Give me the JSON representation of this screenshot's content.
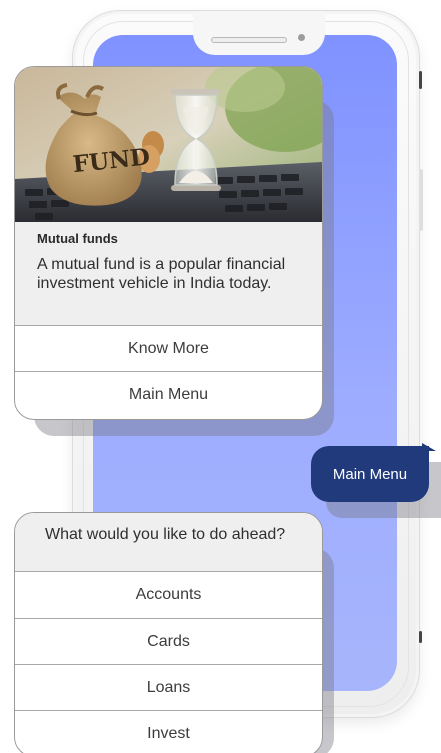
{
  "card_primary": {
    "title": "Mutual funds",
    "description": "A mutual fund is a popular financial investment vehicle in India today.",
    "image_label": "FUND",
    "buttons": [
      "Know More",
      "Main Menu"
    ]
  },
  "user_message": {
    "text": "Main Menu"
  },
  "card_menu": {
    "prompt": "What would you like to do ahead?",
    "options": [
      "Accounts",
      "Cards",
      "Loans",
      "Invest"
    ]
  },
  "colors": {
    "screen_gradient_top": "#7f92ff",
    "screen_gradient_bottom": "#a7b5fc",
    "user_bubble": "#203a7c",
    "card_header_bg": "#efefef"
  }
}
